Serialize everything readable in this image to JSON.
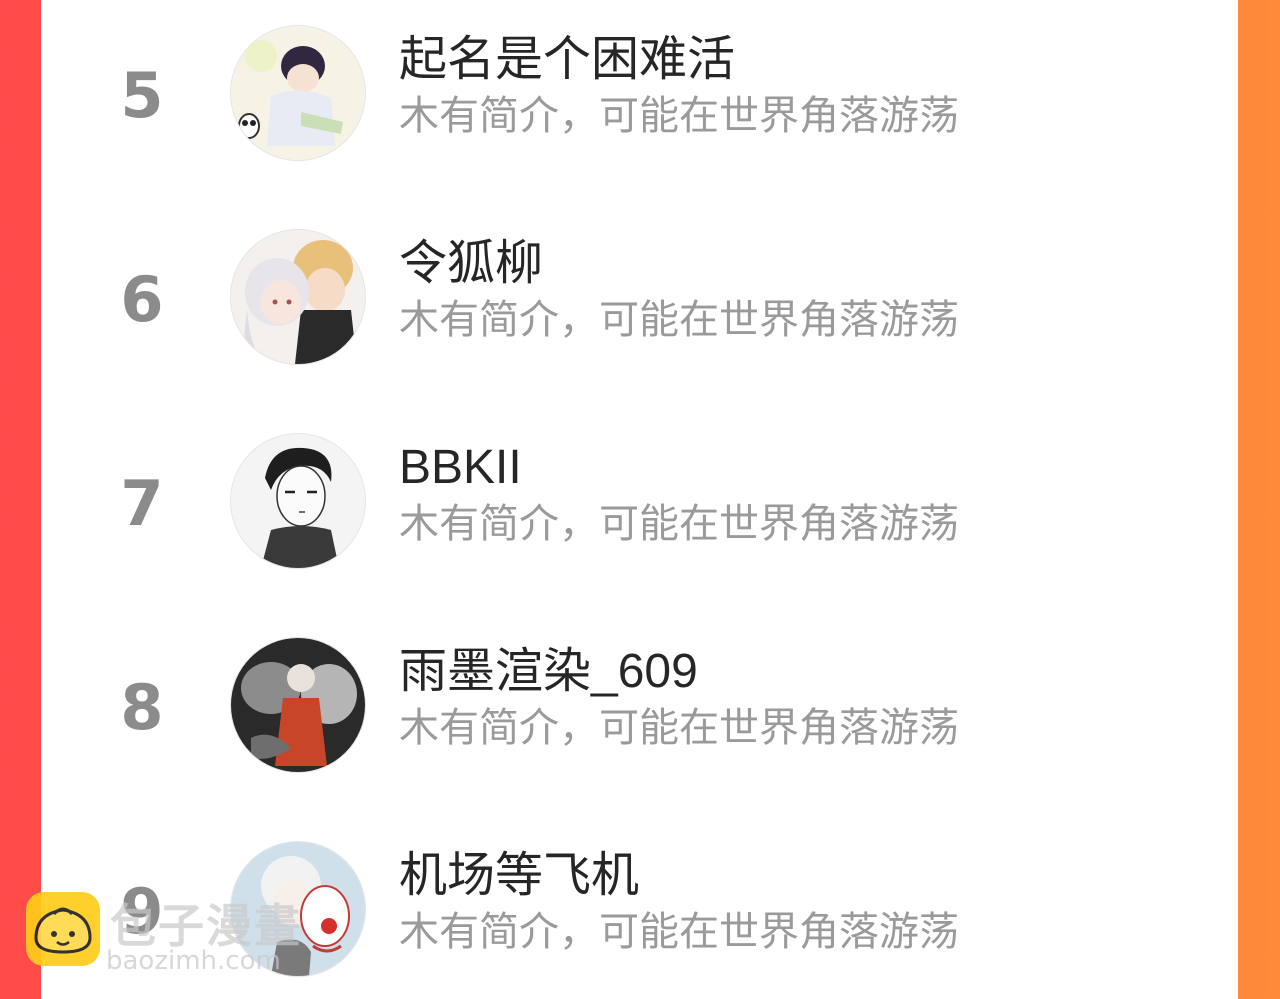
{
  "ranking": {
    "items": [
      {
        "rank": "5",
        "name": "起名是个困难活",
        "bio": "木有简介，可能在世界角落游荡",
        "avatar": "anime-boy-writing-avatar"
      },
      {
        "rank": "6",
        "name": "令狐柳",
        "bio": "木有简介，可能在世界角落游荡",
        "avatar": "two-anime-characters-avatar"
      },
      {
        "rank": "7",
        "name": "BBKII",
        "bio": "木有简介，可能在世界角落游荡",
        "avatar": "ink-sketch-boy-avatar"
      },
      {
        "rank": "8",
        "name": "雨墨渲染_609",
        "bio": "木有简介，可能在世界角落游荡",
        "avatar": "dark-illustration-avatar"
      },
      {
        "rank": "9",
        "name": "机场等飞机",
        "bio": "木有简介，可能在世界角落游荡",
        "avatar": "clown-mask-character-avatar"
      }
    ]
  },
  "watermark": {
    "title": "包子漫畫",
    "url": "baozimh.com",
    "logo_icon": "bun-mascot-icon"
  },
  "colors": {
    "side_left": "#ff4b4b",
    "side_right": "#ff8a3a",
    "rank_text": "#8b8b8b",
    "name_text": "#262626",
    "bio_text": "#9a9a9a",
    "logo_yellow": "#ffcc1a"
  }
}
